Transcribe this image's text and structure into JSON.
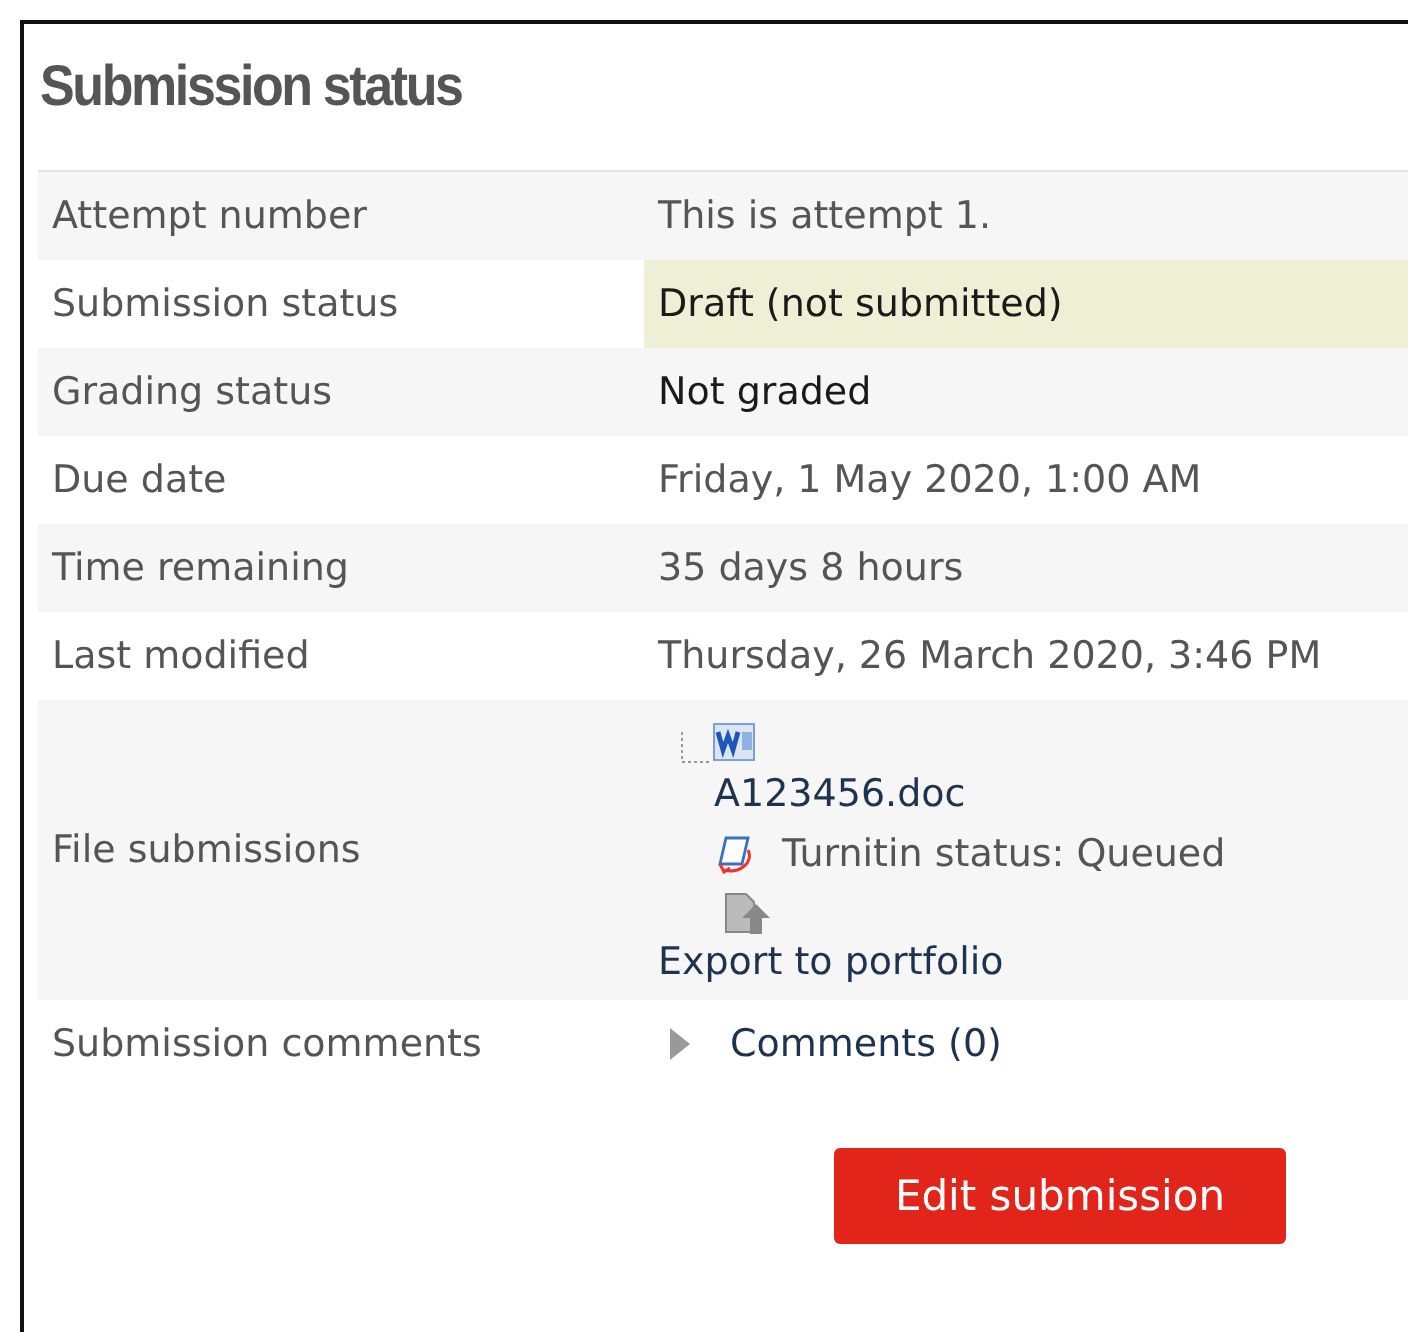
{
  "title": "Submission status",
  "rows": [
    {
      "kind": "text",
      "label": "Attempt number",
      "value": "This is attempt 1.",
      "highlighted": false,
      "strong": false
    },
    {
      "kind": "text",
      "label": "Submission status",
      "value": "Draft (not submitted)",
      "highlighted": true,
      "strong": true
    },
    {
      "kind": "text",
      "label": "Grading status",
      "value": "Not graded",
      "highlighted": false,
      "strong": true
    },
    {
      "kind": "text",
      "label": "Due date",
      "value": "Friday, 1 May 2020, 1:00 AM",
      "highlighted": false,
      "strong": false
    },
    {
      "kind": "text",
      "label": "Time remaining",
      "value": "35 days 8 hours",
      "highlighted": false,
      "strong": false
    },
    {
      "kind": "text",
      "label": "Last modified",
      "value": "Thursday, 26 March 2020, 3:46 PM",
      "highlighted": false,
      "strong": false
    },
    {
      "kind": "files",
      "label": "File submissions",
      "file": "A123456.doc",
      "plagiarism": "Turnitin status: Queued",
      "export": "Export to portfolio"
    },
    {
      "kind": "comments",
      "label": "Submission comments",
      "link": "Comments (0)",
      "expanded": false
    }
  ],
  "button": "Edit submission"
}
